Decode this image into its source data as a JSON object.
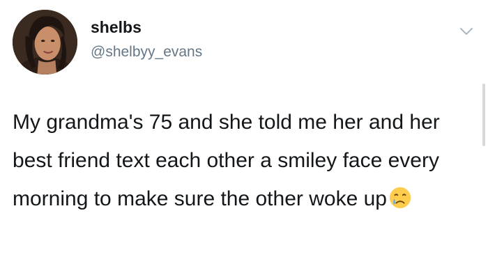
{
  "tweet": {
    "display_name": "shelbs",
    "handle": "@shelbyy_evans",
    "text": "My grandma's 75 and she told me her and her best friend text each other a smiley face every morning to make sure the other woke up",
    "emoji": "crying-face-emoji"
  },
  "icons": {
    "caret": "chevron-down-icon",
    "avatar": "avatar"
  },
  "colors": {
    "name": "#14171a",
    "handle": "#657786",
    "background": "#ffffff"
  }
}
